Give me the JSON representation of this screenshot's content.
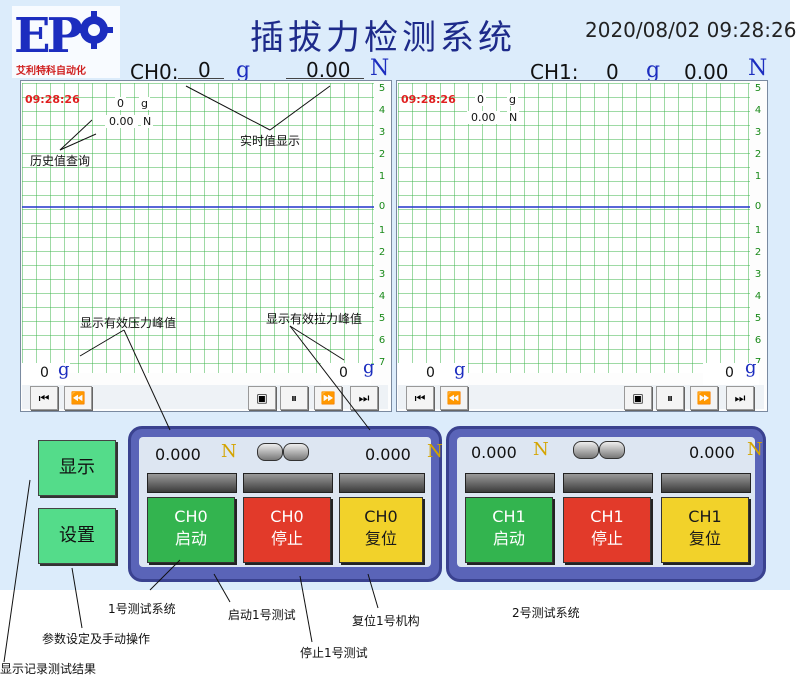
{
  "header": {
    "logo_letters": "EP",
    "logo_sub": "艾利特科自动化",
    "title": "插拔力检测系统",
    "datetime": "2020/08/02 09:28:26"
  },
  "channels": [
    {
      "name": "CH0:",
      "force_g": "0",
      "unit_g": "g",
      "force_n": "0.00",
      "unit_n": "N"
    },
    {
      "name": "CH1:",
      "force_g": "0",
      "unit_g": "g",
      "force_n": "0.00",
      "unit_n": "N"
    }
  ],
  "chart": {
    "ticks": [
      "5",
      "4",
      "3",
      "2",
      "1",
      "0",
      "1",
      "2",
      "3",
      "4",
      "5",
      "6",
      "7"
    ],
    "left": {
      "time": "09:28:26",
      "g": "0",
      "g_unit": "g",
      "n": "0.00",
      "n_unit": "N",
      "bottom_g": "0",
      "bottom_g_unit": "g",
      "bottom_g_right": "0",
      "bottom_g_right_unit": "g"
    },
    "right": {
      "time": "09:28:26",
      "g": "0",
      "g_unit": "g",
      "n": "0.00",
      "n_unit": "N",
      "bottom_g": "0",
      "bottom_g_unit": "g",
      "bottom_g_right": "0",
      "bottom_g_right_unit": "g"
    },
    "toolbar": {
      "first": "⏮",
      "rewind": "⏪",
      "mode": "▣",
      "pause": "⏸",
      "forward": "⏩",
      "last": "⏭"
    }
  },
  "chart_annotations": {
    "realtime": "实时值显示",
    "history": "历史值查询",
    "comp_peak": "显示有效压力峰值",
    "tension_peak": "显示有效拉力峰值"
  },
  "side": {
    "display": "显示",
    "settings": "设置"
  },
  "panel0": {
    "left_val": "0.000",
    "left_unit": "N",
    "right_val": "0.000",
    "right_unit": "N",
    "start": {
      "ch": "CH0",
      "label": "启动"
    },
    "stop": {
      "ch": "CH0",
      "label": "停止"
    },
    "reset": {
      "ch": "CH0",
      "label": "复位"
    }
  },
  "panel1": {
    "left_val": "0.000",
    "left_unit": "N",
    "right_val": "0.000",
    "right_unit": "N",
    "start": {
      "ch": "CH1",
      "label": "启动"
    },
    "stop": {
      "ch": "CH1",
      "label": "停止"
    },
    "reset": {
      "ch": "CH1",
      "label": "复位"
    }
  },
  "annotations": {
    "system1": "1号测试系统",
    "start1": "启动1号测试",
    "reset1": "复位1号机构",
    "system2": "2号测试系统",
    "params": "参数设定及手动操作",
    "stop1": "停止1号测试",
    "records": "显示记录测试结果"
  },
  "colors": {
    "grid": "#3cb44b",
    "zero_line": "#2233cc",
    "panel": "#5a64b8",
    "accent": "#1c2dbf"
  }
}
